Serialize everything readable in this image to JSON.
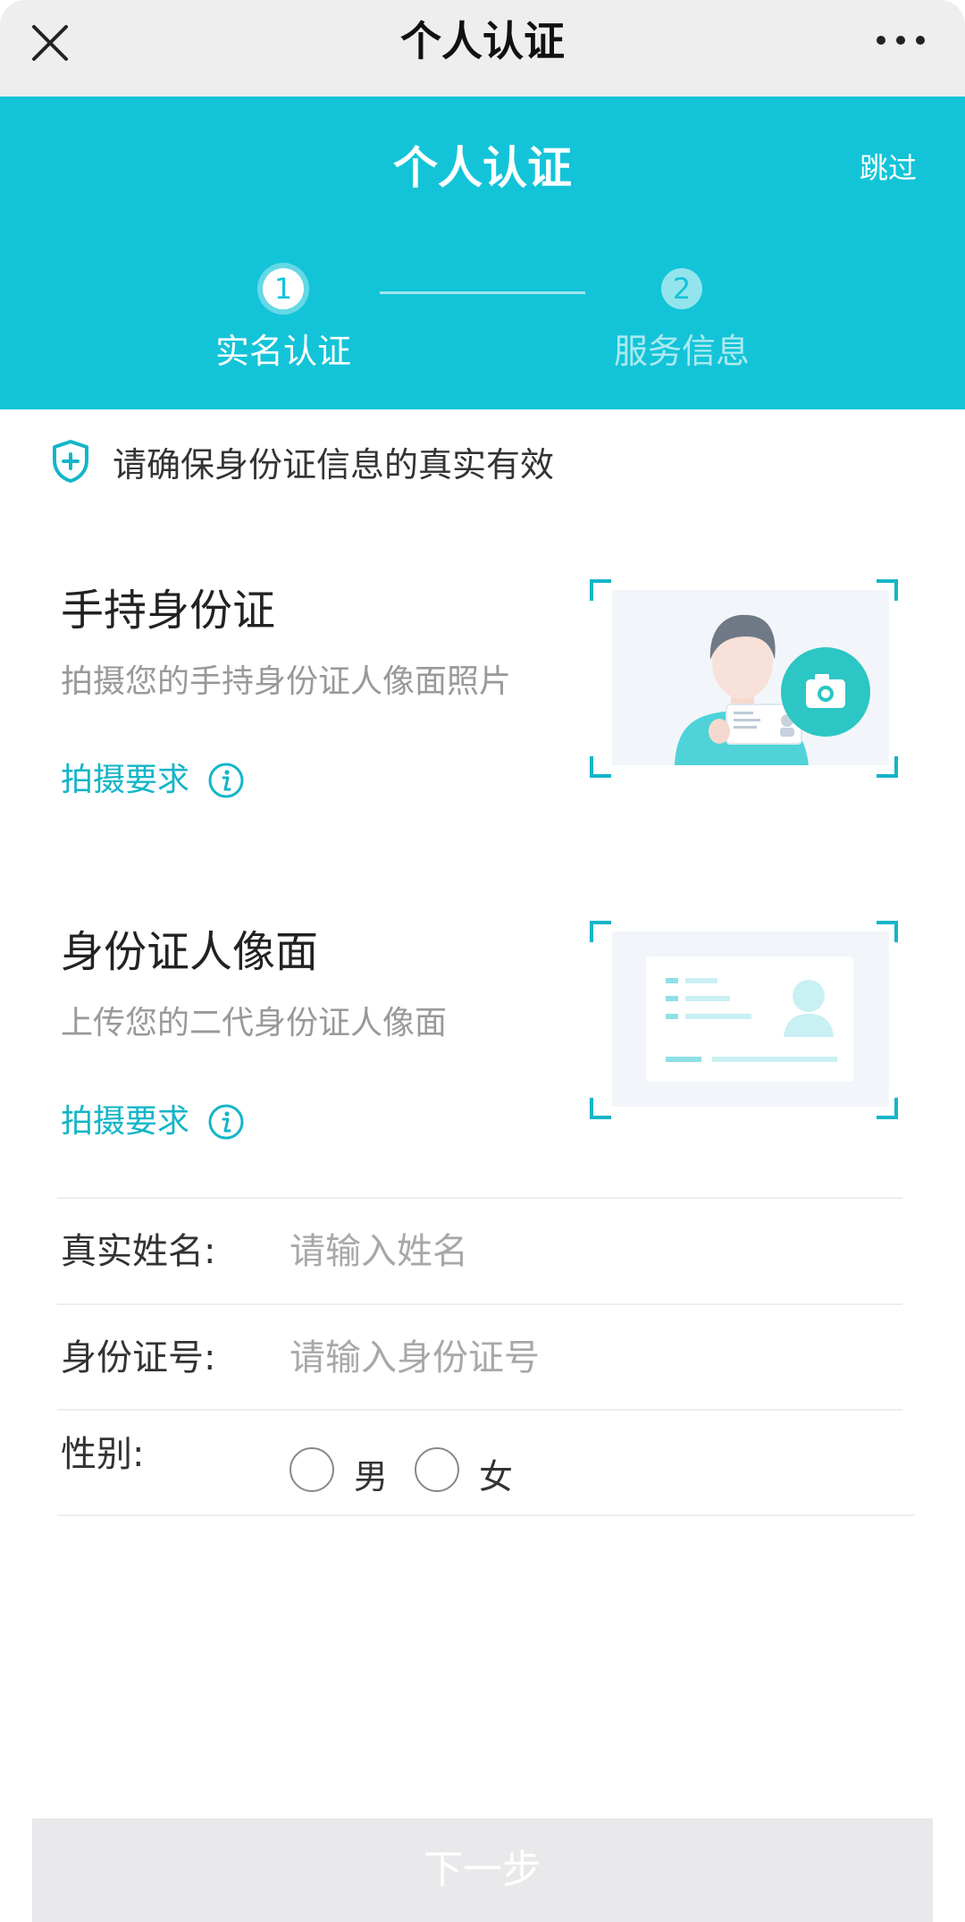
{
  "appbar": {
    "title": "个人认证"
  },
  "header": {
    "title": "个人认证",
    "skip_label": "跳过",
    "steps": [
      {
        "number": "1",
        "label": "实名认证",
        "state": "active"
      },
      {
        "number": "2",
        "label": "服务信息",
        "state": "inactive"
      }
    ]
  },
  "notice": {
    "text": "请确保身份证信息的真实有效",
    "icon": "shield-plus-icon"
  },
  "uploads": [
    {
      "title": "手持身份证",
      "description": "拍摄您的手持身份证人像面照片",
      "requirement_label": "拍摄要求",
      "image": "person-holding-id-illustration"
    },
    {
      "title": "身份证人像面",
      "description": "上传您的二代身份证人像面",
      "requirement_label": "拍摄要求",
      "image": "id-card-front-illustration"
    }
  ],
  "form": {
    "name": {
      "label": "真实姓名:",
      "placeholder": "请输入姓名",
      "value": ""
    },
    "id_number": {
      "label": "身份证号:",
      "placeholder": "请输入身份证号",
      "value": ""
    },
    "gender": {
      "label": "性别:",
      "options": [
        "男",
        "女"
      ],
      "selected": null
    }
  },
  "next_button": {
    "label": "下一步",
    "enabled": false
  },
  "colors": {
    "accent": "#13c4d8",
    "accent_text": "#13b5c8",
    "disabled_button": "#e9e9ec"
  }
}
